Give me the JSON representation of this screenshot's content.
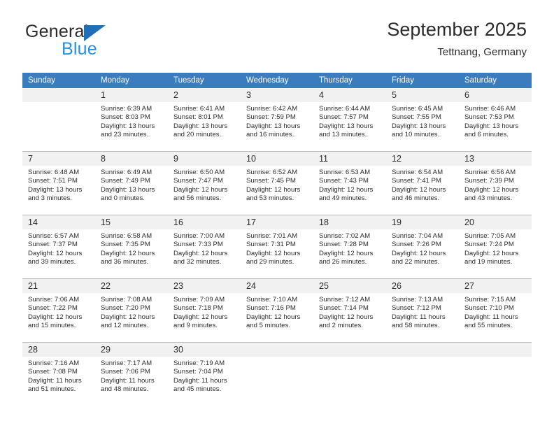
{
  "brand": {
    "name_part1": "General",
    "name_part2": "Blue",
    "triangle_color": "#1f6fb5",
    "blue_color": "#2790dd"
  },
  "header": {
    "title": "September 2025",
    "subtitle": "Tettnang, Germany",
    "header_bg": "#3a7cbe",
    "day_band_bg": "#f1f1f1"
  },
  "weekdays": [
    "Sunday",
    "Monday",
    "Tuesday",
    "Wednesday",
    "Thursday",
    "Friday",
    "Saturday"
  ],
  "weeks": [
    [
      {
        "day": "",
        "sunrise": "",
        "sunset": "",
        "daylight1": "",
        "daylight2": ""
      },
      {
        "day": "1",
        "sunrise": "Sunrise: 6:39 AM",
        "sunset": "Sunset: 8:03 PM",
        "daylight1": "Daylight: 13 hours",
        "daylight2": "and 23 minutes."
      },
      {
        "day": "2",
        "sunrise": "Sunrise: 6:41 AM",
        "sunset": "Sunset: 8:01 PM",
        "daylight1": "Daylight: 13 hours",
        "daylight2": "and 20 minutes."
      },
      {
        "day": "3",
        "sunrise": "Sunrise: 6:42 AM",
        "sunset": "Sunset: 7:59 PM",
        "daylight1": "Daylight: 13 hours",
        "daylight2": "and 16 minutes."
      },
      {
        "day": "4",
        "sunrise": "Sunrise: 6:44 AM",
        "sunset": "Sunset: 7:57 PM",
        "daylight1": "Daylight: 13 hours",
        "daylight2": "and 13 minutes."
      },
      {
        "day": "5",
        "sunrise": "Sunrise: 6:45 AM",
        "sunset": "Sunset: 7:55 PM",
        "daylight1": "Daylight: 13 hours",
        "daylight2": "and 10 minutes."
      },
      {
        "day": "6",
        "sunrise": "Sunrise: 6:46 AM",
        "sunset": "Sunset: 7:53 PM",
        "daylight1": "Daylight: 13 hours",
        "daylight2": "and 6 minutes."
      }
    ],
    [
      {
        "day": "7",
        "sunrise": "Sunrise: 6:48 AM",
        "sunset": "Sunset: 7:51 PM",
        "daylight1": "Daylight: 13 hours",
        "daylight2": "and 3 minutes."
      },
      {
        "day": "8",
        "sunrise": "Sunrise: 6:49 AM",
        "sunset": "Sunset: 7:49 PM",
        "daylight1": "Daylight: 13 hours",
        "daylight2": "and 0 minutes."
      },
      {
        "day": "9",
        "sunrise": "Sunrise: 6:50 AM",
        "sunset": "Sunset: 7:47 PM",
        "daylight1": "Daylight: 12 hours",
        "daylight2": "and 56 minutes."
      },
      {
        "day": "10",
        "sunrise": "Sunrise: 6:52 AM",
        "sunset": "Sunset: 7:45 PM",
        "daylight1": "Daylight: 12 hours",
        "daylight2": "and 53 minutes."
      },
      {
        "day": "11",
        "sunrise": "Sunrise: 6:53 AM",
        "sunset": "Sunset: 7:43 PM",
        "daylight1": "Daylight: 12 hours",
        "daylight2": "and 49 minutes."
      },
      {
        "day": "12",
        "sunrise": "Sunrise: 6:54 AM",
        "sunset": "Sunset: 7:41 PM",
        "daylight1": "Daylight: 12 hours",
        "daylight2": "and 46 minutes."
      },
      {
        "day": "13",
        "sunrise": "Sunrise: 6:56 AM",
        "sunset": "Sunset: 7:39 PM",
        "daylight1": "Daylight: 12 hours",
        "daylight2": "and 43 minutes."
      }
    ],
    [
      {
        "day": "14",
        "sunrise": "Sunrise: 6:57 AM",
        "sunset": "Sunset: 7:37 PM",
        "daylight1": "Daylight: 12 hours",
        "daylight2": "and 39 minutes."
      },
      {
        "day": "15",
        "sunrise": "Sunrise: 6:58 AM",
        "sunset": "Sunset: 7:35 PM",
        "daylight1": "Daylight: 12 hours",
        "daylight2": "and 36 minutes."
      },
      {
        "day": "16",
        "sunrise": "Sunrise: 7:00 AM",
        "sunset": "Sunset: 7:33 PM",
        "daylight1": "Daylight: 12 hours",
        "daylight2": "and 32 minutes."
      },
      {
        "day": "17",
        "sunrise": "Sunrise: 7:01 AM",
        "sunset": "Sunset: 7:31 PM",
        "daylight1": "Daylight: 12 hours",
        "daylight2": "and 29 minutes."
      },
      {
        "day": "18",
        "sunrise": "Sunrise: 7:02 AM",
        "sunset": "Sunset: 7:28 PM",
        "daylight1": "Daylight: 12 hours",
        "daylight2": "and 26 minutes."
      },
      {
        "day": "19",
        "sunrise": "Sunrise: 7:04 AM",
        "sunset": "Sunset: 7:26 PM",
        "daylight1": "Daylight: 12 hours",
        "daylight2": "and 22 minutes."
      },
      {
        "day": "20",
        "sunrise": "Sunrise: 7:05 AM",
        "sunset": "Sunset: 7:24 PM",
        "daylight1": "Daylight: 12 hours",
        "daylight2": "and 19 minutes."
      }
    ],
    [
      {
        "day": "21",
        "sunrise": "Sunrise: 7:06 AM",
        "sunset": "Sunset: 7:22 PM",
        "daylight1": "Daylight: 12 hours",
        "daylight2": "and 15 minutes."
      },
      {
        "day": "22",
        "sunrise": "Sunrise: 7:08 AM",
        "sunset": "Sunset: 7:20 PM",
        "daylight1": "Daylight: 12 hours",
        "daylight2": "and 12 minutes."
      },
      {
        "day": "23",
        "sunrise": "Sunrise: 7:09 AM",
        "sunset": "Sunset: 7:18 PM",
        "daylight1": "Daylight: 12 hours",
        "daylight2": "and 9 minutes."
      },
      {
        "day": "24",
        "sunrise": "Sunrise: 7:10 AM",
        "sunset": "Sunset: 7:16 PM",
        "daylight1": "Daylight: 12 hours",
        "daylight2": "and 5 minutes."
      },
      {
        "day": "25",
        "sunrise": "Sunrise: 7:12 AM",
        "sunset": "Sunset: 7:14 PM",
        "daylight1": "Daylight: 12 hours",
        "daylight2": "and 2 minutes."
      },
      {
        "day": "26",
        "sunrise": "Sunrise: 7:13 AM",
        "sunset": "Sunset: 7:12 PM",
        "daylight1": "Daylight: 11 hours",
        "daylight2": "and 58 minutes."
      },
      {
        "day": "27",
        "sunrise": "Sunrise: 7:15 AM",
        "sunset": "Sunset: 7:10 PM",
        "daylight1": "Daylight: 11 hours",
        "daylight2": "and 55 minutes."
      }
    ],
    [
      {
        "day": "28",
        "sunrise": "Sunrise: 7:16 AM",
        "sunset": "Sunset: 7:08 PM",
        "daylight1": "Daylight: 11 hours",
        "daylight2": "and 51 minutes."
      },
      {
        "day": "29",
        "sunrise": "Sunrise: 7:17 AM",
        "sunset": "Sunset: 7:06 PM",
        "daylight1": "Daylight: 11 hours",
        "daylight2": "and 48 minutes."
      },
      {
        "day": "30",
        "sunrise": "Sunrise: 7:19 AM",
        "sunset": "Sunset: 7:04 PM",
        "daylight1": "Daylight: 11 hours",
        "daylight2": "and 45 minutes."
      },
      {
        "day": "",
        "sunrise": "",
        "sunset": "",
        "daylight1": "",
        "daylight2": ""
      },
      {
        "day": "",
        "sunrise": "",
        "sunset": "",
        "daylight1": "",
        "daylight2": ""
      },
      {
        "day": "",
        "sunrise": "",
        "sunset": "",
        "daylight1": "",
        "daylight2": ""
      },
      {
        "day": "",
        "sunrise": "",
        "sunset": "",
        "daylight1": "",
        "daylight2": ""
      }
    ]
  ]
}
